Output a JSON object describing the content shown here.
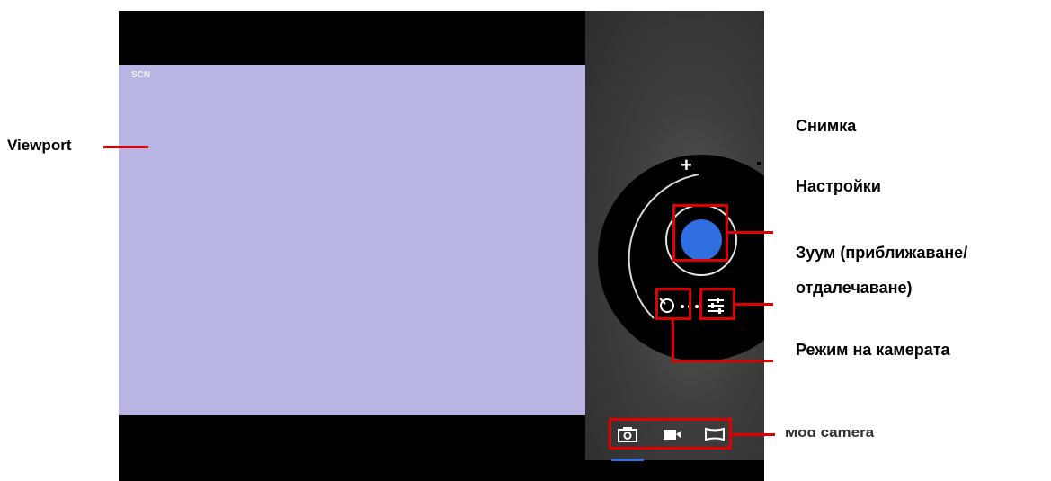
{
  "camera": {
    "scene_mode_label": "SCN",
    "zoom_in_symbol": "+",
    "icons": {
      "shutter": "shutter-icon",
      "camera_mode": "camera-mode-icon",
      "settings": "settings-sliders-icon",
      "mode_photo": "camera-icon",
      "mode_video": "video-icon",
      "mode_panorama": "panorama-icon"
    },
    "colors": {
      "viewport": "#b8b4e4",
      "shutter": "#2f6fe0",
      "callout": "#e00000"
    }
  },
  "callouts": {
    "viewport": "Viewport",
    "capture": "Снимка",
    "settings": "Настройки",
    "zoom_line1": "Зуум (приближаване/",
    "zoom_line2": "отдалечаване)",
    "camera_mode": "Режим на камерата",
    "mod_camera": "Mod camera"
  }
}
